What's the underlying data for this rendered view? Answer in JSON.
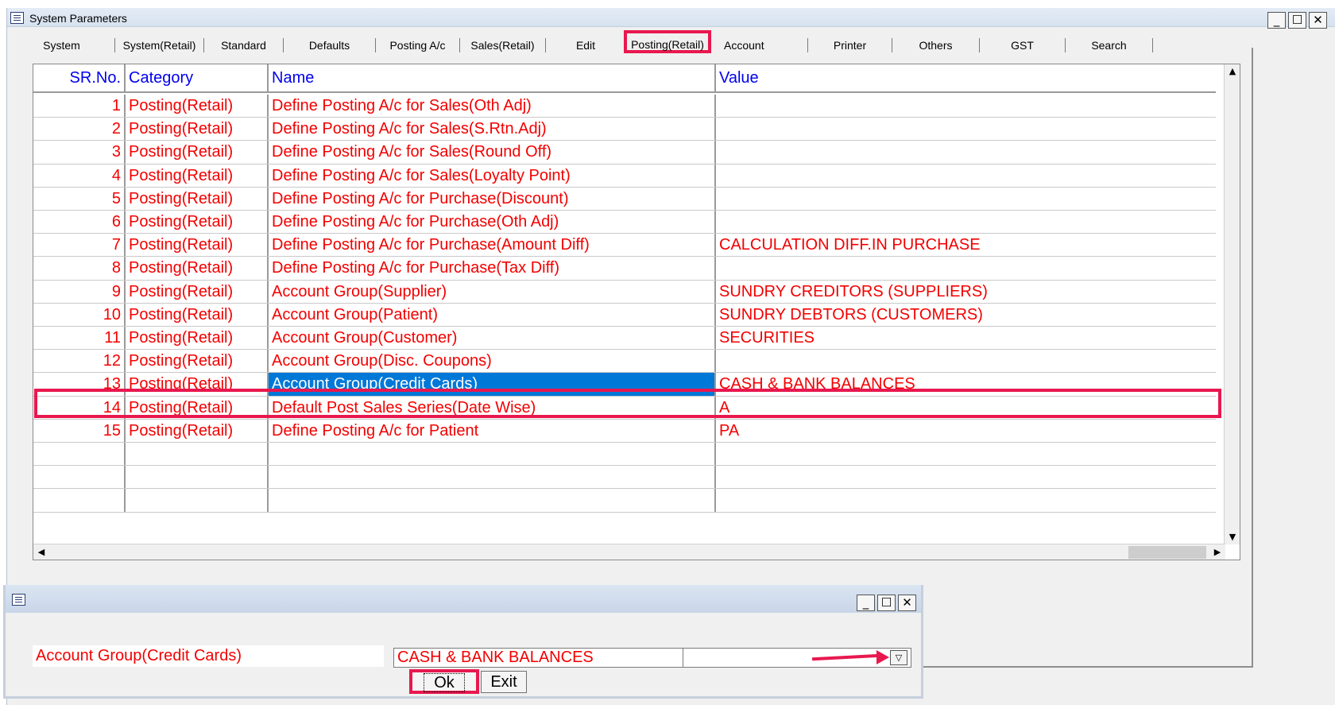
{
  "window": {
    "title": "System Parameters",
    "minimize": "_",
    "maximize": "☐",
    "close": "✕"
  },
  "tabs": [
    {
      "label": "System"
    },
    {
      "label": "System(Retail)"
    },
    {
      "label": "Standard"
    },
    {
      "label": "Defaults"
    },
    {
      "label": "Posting A/c"
    },
    {
      "label": "Sales(Retail)"
    },
    {
      "label": "Edit"
    },
    {
      "label": "Posting(Retail)"
    },
    {
      "label": "Account"
    },
    {
      "label": "Printer"
    },
    {
      "label": "Others"
    },
    {
      "label": "GST"
    },
    {
      "label": "Search"
    }
  ],
  "active_tab": "Posting(Retail)",
  "grid": {
    "columns": [
      "SR.No.",
      "Category",
      "Name",
      "Value"
    ],
    "rows": [
      {
        "sr": "1",
        "category": "Posting(Retail)",
        "name": "Define Posting A/c for Sales(Oth Adj)",
        "value": ""
      },
      {
        "sr": "2",
        "category": "Posting(Retail)",
        "name": "Define Posting A/c for Sales(S.Rtn.Adj)",
        "value": ""
      },
      {
        "sr": "3",
        "category": "Posting(Retail)",
        "name": "Define Posting A/c for Sales(Round Off)",
        "value": ""
      },
      {
        "sr": "4",
        "category": "Posting(Retail)",
        "name": "Define Posting A/c for Sales(Loyalty Point)",
        "value": ""
      },
      {
        "sr": "5",
        "category": "Posting(Retail)",
        "name": "Define Posting A/c for Purchase(Discount)",
        "value": ""
      },
      {
        "sr": "6",
        "category": "Posting(Retail)",
        "name": "Define Posting A/c for Purchase(Oth Adj)",
        "value": ""
      },
      {
        "sr": "7",
        "category": "Posting(Retail)",
        "name": "Define Posting A/c for Purchase(Amount Diff)",
        "value": "CALCULATION DIFF.IN PURCHASE"
      },
      {
        "sr": "8",
        "category": "Posting(Retail)",
        "name": "Define Posting A/c for Purchase(Tax Diff)",
        "value": ""
      },
      {
        "sr": "9",
        "category": "Posting(Retail)",
        "name": "Account Group(Supplier)",
        "value": "SUNDRY CREDITORS (SUPPLIERS)"
      },
      {
        "sr": "10",
        "category": "Posting(Retail)",
        "name": "Account Group(Patient)",
        "value": "SUNDRY DEBTORS (CUSTOMERS)"
      },
      {
        "sr": "11",
        "category": "Posting(Retail)",
        "name": "Account Group(Customer)",
        "value": "SECURITIES"
      },
      {
        "sr": "12",
        "category": "Posting(Retail)",
        "name": "Account Group(Disc. Coupons)",
        "value": ""
      },
      {
        "sr": "13",
        "category": "Posting(Retail)",
        "name": "Account Group(Credit Cards)",
        "value": "CASH & BANK BALANCES"
      },
      {
        "sr": "14",
        "category": "Posting(Retail)",
        "name": "Default Post Sales Series(Date Wise)",
        "value": "A"
      },
      {
        "sr": "15",
        "category": "Posting(Retail)",
        "name": "Define Posting A/c for Patient",
        "value": "PA"
      }
    ],
    "empty_rows": 3,
    "selected_sr": "13"
  },
  "scroll": {
    "up": "▲",
    "down": "▼",
    "left": "◀",
    "right": "▶"
  },
  "dialog": {
    "field_label": "Account Group(Credit Cards)",
    "value": "CASH & BANK BALANCES",
    "dropdown_glyph": "▽",
    "ok_label": "Ok",
    "exit_label": "Exit"
  },
  "colors": {
    "text_red": "#f30000",
    "header_blue": "#0000ee",
    "selection_blue": "#0078d7",
    "highlight": "#e8184f"
  }
}
